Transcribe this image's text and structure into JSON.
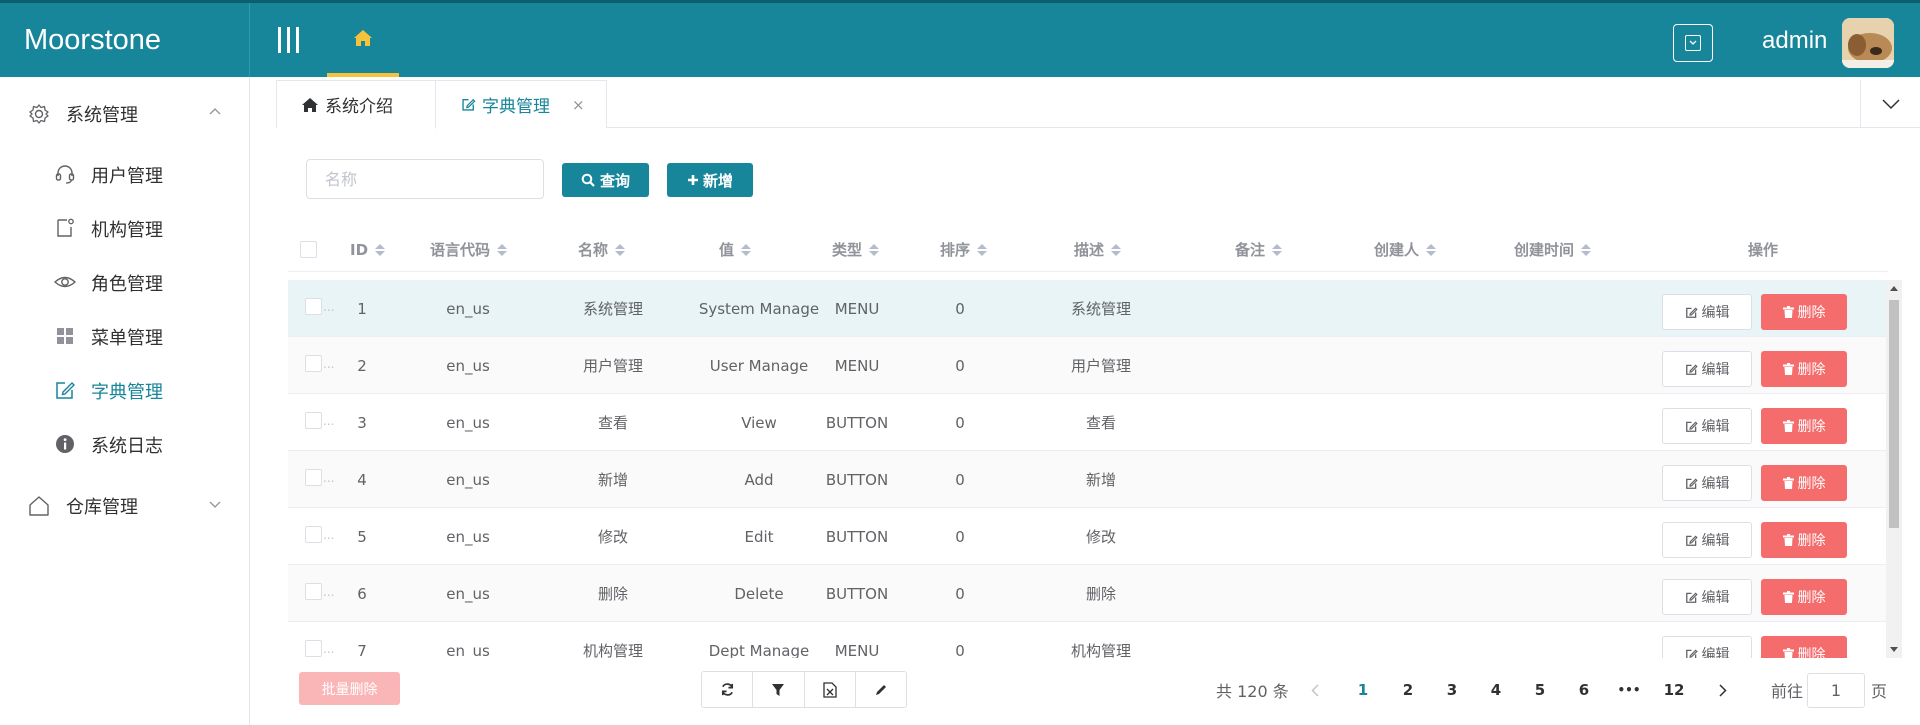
{
  "header": {
    "brand": "Moorstone",
    "username": "admin",
    "accent_color": "#17859a",
    "home_indicator_color": "#f5c33b"
  },
  "sidebar": {
    "groups": [
      {
        "label": "系统管理",
        "icon": "gear-icon",
        "expanded": true
      },
      {
        "label": "仓库管理",
        "icon": "home-outline-icon",
        "expanded": false
      }
    ],
    "items": [
      {
        "label": "用户管理",
        "icon": "headset-icon"
      },
      {
        "label": "机构管理",
        "icon": "document-icon"
      },
      {
        "label": "角色管理",
        "icon": "eye-icon"
      },
      {
        "label": "菜单管理",
        "icon": "grid-icon"
      },
      {
        "label": "字典管理",
        "icon": "edit-icon",
        "active": true
      },
      {
        "label": "系统日志",
        "icon": "info-icon"
      }
    ]
  },
  "tabs": [
    {
      "label": "系统介绍",
      "icon": "home-icon"
    },
    {
      "label": "字典管理",
      "icon": "edit-icon",
      "active": true,
      "close": "×"
    }
  ],
  "toolbar": {
    "search_placeholder": "名称",
    "query_label": "查询",
    "add_label": "新增"
  },
  "table": {
    "columns": [
      "ID",
      "语言代码",
      "名称",
      "值",
      "类型",
      "排序",
      "描述",
      "备注",
      "创建人",
      "创建时间",
      "操作"
    ],
    "rows": [
      {
        "id": "1",
        "lang": "en_us",
        "name": "系统管理",
        "value": "System Manage",
        "type": "MENU",
        "sort": "0",
        "desc": "系统管理",
        "remark": "",
        "creator": "",
        "created": ""
      },
      {
        "id": "2",
        "lang": "en_us",
        "name": "用户管理",
        "value": "User Manage",
        "type": "MENU",
        "sort": "0",
        "desc": "用户管理",
        "remark": "",
        "creator": "",
        "created": ""
      },
      {
        "id": "3",
        "lang": "en_us",
        "name": "查看",
        "value": "View",
        "type": "BUTTON",
        "sort": "0",
        "desc": "查看",
        "remark": "",
        "creator": "",
        "created": ""
      },
      {
        "id": "4",
        "lang": "en_us",
        "name": "新增",
        "value": "Add",
        "type": "BUTTON",
        "sort": "0",
        "desc": "新增",
        "remark": "",
        "creator": "",
        "created": ""
      },
      {
        "id": "5",
        "lang": "en_us",
        "name": "修改",
        "value": "Edit",
        "type": "BUTTON",
        "sort": "0",
        "desc": "修改",
        "remark": "",
        "creator": "",
        "created": ""
      },
      {
        "id": "6",
        "lang": "en_us",
        "name": "删除",
        "value": "Delete",
        "type": "BUTTON",
        "sort": "0",
        "desc": "删除",
        "remark": "",
        "creator": "",
        "created": ""
      },
      {
        "id": "7",
        "lang": "en_us",
        "name": "机构管理",
        "value": "Dept Manage",
        "type": "MENU",
        "sort": "0",
        "desc": "机构管理",
        "remark": "",
        "creator": "",
        "created": ""
      }
    ],
    "edit_label": "编辑",
    "delete_label": "删除",
    "row_checkbox_ellipsis": "..."
  },
  "footer": {
    "batch_delete_label": "批量删除",
    "total_text": "共 120 条",
    "pages": [
      "1",
      "2",
      "3",
      "4",
      "5",
      "6",
      "•••",
      "12"
    ],
    "current_page": "1",
    "goto_label": "前往",
    "goto_value": "1",
    "page_suffix": "页",
    "tool_icons": [
      "refresh-icon",
      "filter-icon",
      "excel-export-icon",
      "pencil-icon"
    ]
  }
}
